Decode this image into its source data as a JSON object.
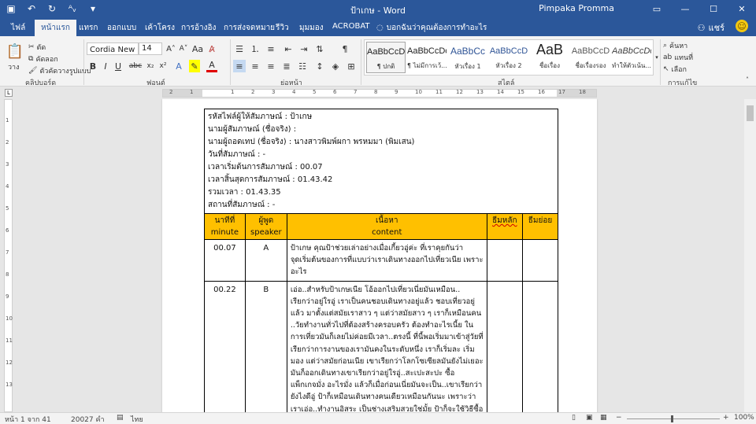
{
  "window": {
    "title": "ป้าเกษ - Word",
    "user": "Pimpaka Promma",
    "controls": {
      "ribbon_options": "▭",
      "minimize": "—",
      "maximize": "☐",
      "close": "✕"
    }
  },
  "qat": {
    "save_icon": "save-icon",
    "undo_icon": "undo-icon",
    "redo_icon": "redo-icon",
    "spelling_icon": "spelling-icon"
  },
  "tabs": [
    {
      "label": "ไฟล์"
    },
    {
      "label": "หน้าแรก"
    },
    {
      "label": "แทรก"
    },
    {
      "label": "ออกแบบ"
    },
    {
      "label": "เค้าโครง"
    },
    {
      "label": "การอ้างอิง"
    },
    {
      "label": "การส่งจดหมาย"
    },
    {
      "label": "รีวิว"
    },
    {
      "label": "มุมมอง"
    },
    {
      "label": "ACROBAT"
    }
  ],
  "tellme": "บอกฉันว่าคุณต้องการทำอะไร",
  "share_label": "แชร์",
  "ribbon": {
    "clipboard": {
      "paste": "วาง",
      "cut": "ตัด",
      "copy": "คัดลอก",
      "format_painter": "ตัวคัดวางรูปแบบ",
      "group": "คลิปบอร์ด"
    },
    "font": {
      "name": "Cordia New (เนื้",
      "size": "14",
      "group": "ฟอนต์"
    },
    "paragraph": {
      "group": "ย่อหน้า"
    },
    "styles": {
      "group": "สไตล์",
      "items": [
        {
          "sample": "AaBbCcDc",
          "name": "¶ ปกติ"
        },
        {
          "sample": "AaBbCcDc",
          "name": "¶ ไม่มีการเว้..."
        },
        {
          "sample": "AaBbCc",
          "name": "หัวเรื่อง 1"
        },
        {
          "sample": "AaBbCcD",
          "name": "หัวเรื่อง 2"
        },
        {
          "sample": "AaB",
          "name": "ชื่อเรื่อง"
        },
        {
          "sample": "AaBbCcD",
          "name": "ชื่อเรื่องรอง"
        },
        {
          "sample": "AaBbCcDc",
          "name": "ทำให้ตัวเน้น..."
        }
      ]
    },
    "editing": {
      "find": "ค้นหา",
      "replace": "แทนที่",
      "select": "เลือก",
      "group": "การแก้ไข"
    }
  },
  "document": {
    "header_lines": [
      "รหัสไฟล์ผู้ให้สัมภาษณ์ : ป้าเกษ",
      "นามผู้สัมภาษณ์ (ชื่อจริง) :",
      "นามผู้ถอดเทป (ชื่อจริง) : นางสาวพิมพ์ผกา พรหมมา (พิมเสน)",
      "วันที่สัมภาษณ์ : -",
      "เวลาเริ่มต้นการสัมภาษณ์ : 00.07",
      "เวลาสิ้นสุดการสัมภาษณ์ : 01.43.42",
      "รวมเวลา : 01.43.35",
      "สถานที่สัมภาษณ์ : -"
    ],
    "columns": [
      {
        "th": "นาทีที่",
        "en": "minute"
      },
      {
        "th": "ผู้พูด",
        "en": "speaker"
      },
      {
        "th": "เนื้อหา",
        "en": "content"
      },
      {
        "th": "ธีมหลัก",
        "en": ""
      },
      {
        "th": "ธีมย่อย",
        "en": ""
      }
    ],
    "rows": [
      {
        "minute": "00.07",
        "speaker": "A",
        "lines": [
          "ป้าเกษ คุณป้าช่วยเล่าอย่างเมื่อเกี้ยวอู่ค่ะ ที่เราคุยกันว่า",
          "จุดเริ่มต้นของการที่แบบว่าเราเดินทางออกไปเที่ยวเนีย เพราะ",
          "อะไร"
        ]
      },
      {
        "minute": "00.22",
        "speaker": "B",
        "lines": [
          "เอ่อ..สำหรับป้าเกษเนีย โอ้ออกไปเที่ยวเนี่ยมันเหมือน..",
          "เรียกว่าอยู่ใรอู่ เราเป็นคนชอบเดินทางอยู่แล้ว ชอบเที่ยวอยู่",
          "แล้ว มาตั้งแต่สมัยเราสาว ๆ แต่ว่าสมัยสาว ๆ เราก็เหมือนคน",
          "..วัยทำงานทั่วไปที่ต้องสร้างครอบครัว ต้องทำอะไรเนี้ย ใน",
          "การเที่ยวมันก็เลยไม่ค่อยมีเวลา..ตรงนี้ ที่นี้พอเริ่มมาเข้าสู่วัยที่",
          "เรียกว่าการงานของเรามันคงในระดับหนึ่ง เราก็เริ่มละ เริ่ม",
          "มอง แต่ว่าสมัยก่อนเนีย เขาเรียกว่าโลกโซเซียลมันยังไม่เยอะ",
          "มันก็ออกเดินทางเขาเรียกว่าอยู่ใรอู่..สะเปะสะปะ ซื้อ",
          "แพ็กเกจมั่ง อะไรมั่ง แล้วก็เมื่อก่อนเนี่ยมันจะเป็น..เขาเรียกว่า",
          "ยังไงดีอู่ ป้าก็เหมือนเดินทางคนเดียวเหมือนกันนะ เพราะว่า",
          "เราเอ่อ..ทำงานอิสระ เป็นช่างเสริมสวยใช่มั้ย ป้าก็จะใช้วิธีซื้อ"
        ]
      }
    ]
  },
  "status": {
    "page": "หน้า 1 จาก 41",
    "words": "20027 คำ",
    "language": "ไทย",
    "zoom": "100%"
  }
}
